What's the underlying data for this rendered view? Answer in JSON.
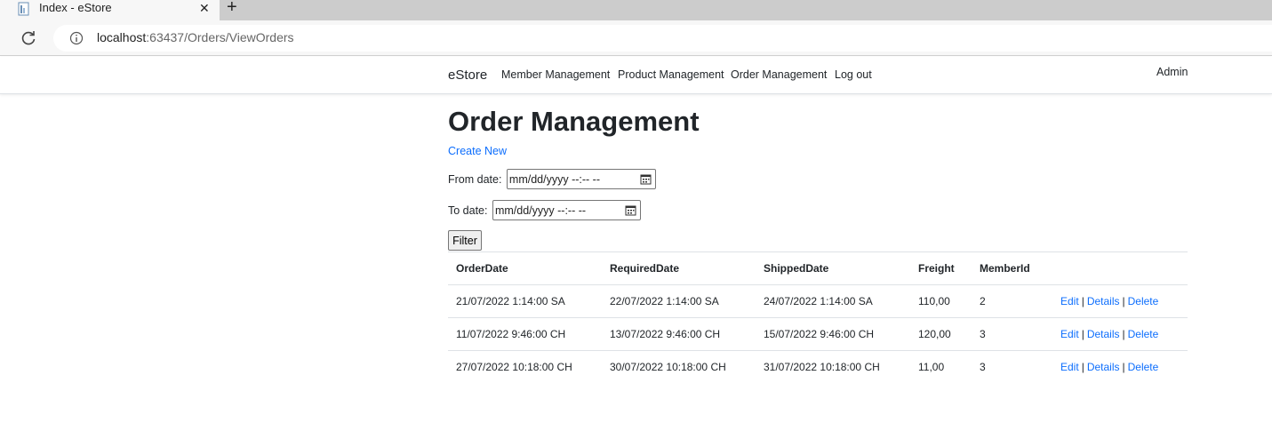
{
  "browser": {
    "tab_title": "Index - eStore",
    "url_host": "localhost",
    "url_rest": ":63437/Orders/ViewOrders"
  },
  "navbar": {
    "brand": "eStore",
    "links": [
      "Member Management",
      "Product Management",
      "Order Management",
      "Log out"
    ],
    "user": "Admin"
  },
  "main": {
    "title": "Order Management",
    "create_new": "Create New",
    "from_label": "From date:",
    "to_label": "To date:",
    "date_placeholder": "mm/dd/yyyy --:-- --",
    "filter_label": "Filter"
  },
  "table": {
    "headers": [
      "OrderDate",
      "RequiredDate",
      "ShippedDate",
      "Freight",
      "MemberId"
    ],
    "rows": [
      [
        "21/07/2022 1:14:00 SA",
        "22/07/2022 1:14:00 SA",
        "24/07/2022 1:14:00 SA",
        "110,00",
        "2"
      ],
      [
        "11/07/2022 9:46:00 CH",
        "13/07/2022 9:46:00 CH",
        "15/07/2022 9:46:00 CH",
        "120,00",
        "3"
      ],
      [
        "27/07/2022 10:18:00 CH",
        "30/07/2022 10:18:00 CH",
        "31/07/2022 10:18:00 CH",
        "11,00",
        "3"
      ]
    ],
    "actions": {
      "edit": "Edit",
      "details": "Details",
      "delete": "Delete",
      "sep": "|"
    }
  },
  "colors": {
    "link": "#0d6efd",
    "text": "#212529"
  }
}
